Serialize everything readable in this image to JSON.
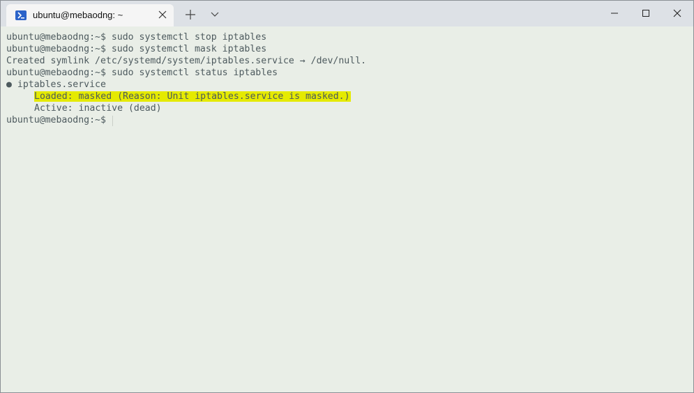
{
  "window": {
    "tab_title": "ubuntu@mebaodng: ~",
    "tab_icon": "powershell-icon",
    "new_tab_icon": "plus-icon",
    "dropdown_icon": "chevron-down-icon",
    "controls": [
      "minimize-icon",
      "maximize-icon",
      "close-icon"
    ]
  },
  "terminal": {
    "lines": [
      "ubuntu@mebaodng:~$ sudo systemctl stop iptables",
      "ubuntu@mebaodng:~$ sudo systemctl mask iptables",
      "Created symlink /etc/systemd/system/iptables.service → /dev/null.",
      "ubuntu@mebaodng:~$ sudo systemctl status iptables",
      "● iptables.service",
      "Loaded: masked (Reason: Unit iptables.service is masked.)",
      "Active: inactive (dead)",
      "ubuntu@mebaodng:~$"
    ],
    "highlight_color": "#e5ea00",
    "text_color": "#4d5a5e",
    "background_color": "#e9eee7"
  }
}
